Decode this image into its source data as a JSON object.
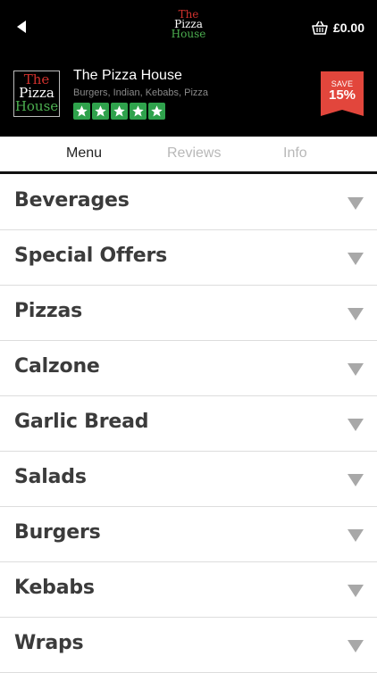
{
  "topbar": {
    "back_icon": "back-arrow-icon",
    "logo_lines": [
      "The",
      "Pizza",
      "House"
    ],
    "basket_icon": "basket-icon",
    "basket_total": "£0.00"
  },
  "restaurant": {
    "logo_lines": [
      "The",
      "Pizza",
      "House"
    ],
    "name": "The Pizza House",
    "cuisines": "Burgers, Indian, Kebabs, Pizza",
    "rating": 5,
    "save_label": "SAVE",
    "save_value": "15%"
  },
  "tabs": [
    {
      "label": "Menu",
      "active": true
    },
    {
      "label": "Reviews",
      "active": false
    },
    {
      "label": "Info",
      "active": false
    }
  ],
  "categories": [
    {
      "label": "Beverages"
    },
    {
      "label": "Special Offers"
    },
    {
      "label": "Pizzas"
    },
    {
      "label": "Calzone"
    },
    {
      "label": "Garlic Bread"
    },
    {
      "label": "Salads"
    },
    {
      "label": "Burgers"
    },
    {
      "label": "Kebabs"
    },
    {
      "label": "Wraps"
    }
  ],
  "colors": {
    "header_bg": "#000000",
    "star_green": "#2fa24c",
    "save_red": "#e2463c",
    "logo_red": "#d0312d",
    "logo_green": "#4caf50"
  }
}
